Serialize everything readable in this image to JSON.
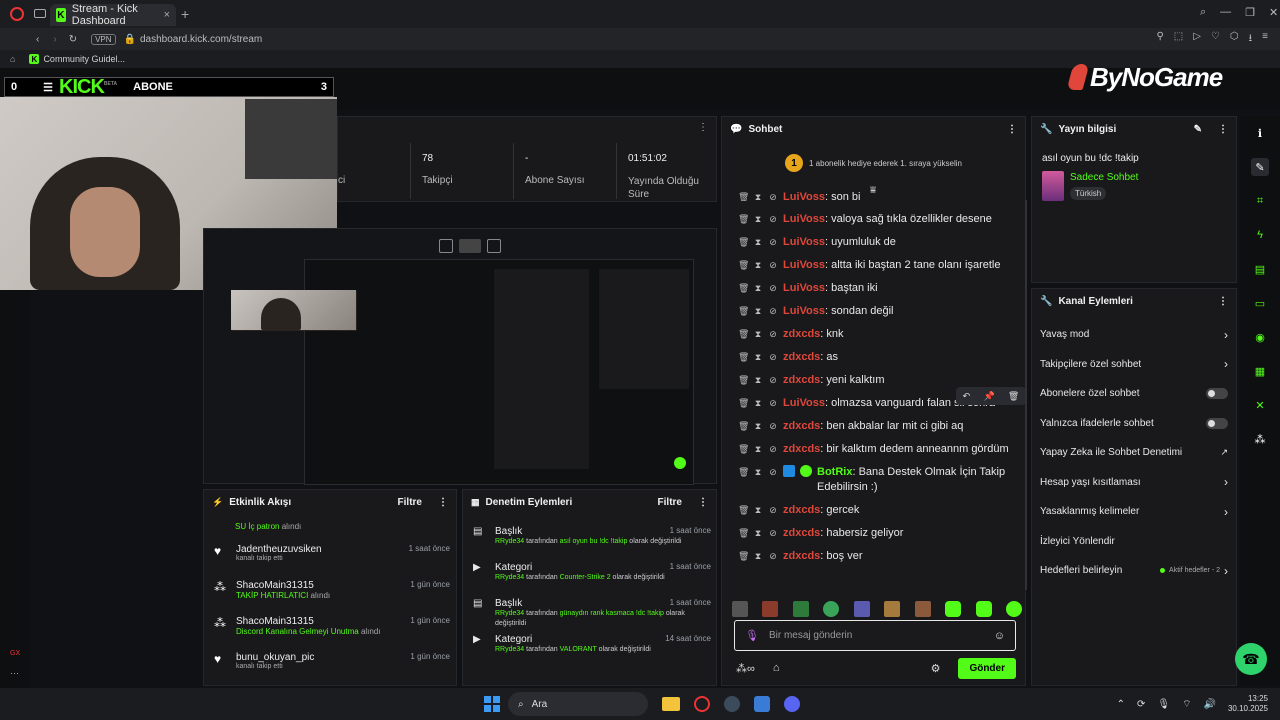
{
  "browser": {
    "tab_title": "Stream - Kick Dashboard",
    "url": "dashboard.kick.com/stream",
    "vpn": "VPN",
    "bookmark": "Community Guidel..."
  },
  "overlay": {
    "brand": "ByNoGame",
    "kick_logo": "KICK",
    "beta": "BETA",
    "abone": "ABONE",
    "abone_count": "3",
    "left_count": "0"
  },
  "stats": {
    "partial_label": "ci",
    "takipci_value": "78",
    "takipci_label": "Takipçi",
    "abone_value": "-",
    "abone_label": "Abone Sayısı",
    "time_value": "01:51:02",
    "time_label": "Yayında Olduğu Süre"
  },
  "chat": {
    "title": "Sohbet",
    "pinned_badge": "1",
    "pinned_text": "1 abonelik hediye ederek 1. sıraya yükselin",
    "cut_user": "LuiVoss",
    "cut_msg": ": son bi",
    "lines": [
      {
        "user": "LuiVoss",
        "color": "red",
        "msg": ": valoya sağ tıkla özellikler desene"
      },
      {
        "user": "LuiVoss",
        "color": "red",
        "msg": ": uyumluluk de"
      },
      {
        "user": "LuiVoss",
        "color": "red",
        "msg": ": altta iki baştan 2 tane olanı işaretle"
      },
      {
        "user": "LuiVoss",
        "color": "red",
        "msg": ": baştan iki"
      },
      {
        "user": "LuiVoss",
        "color": "red",
        "msg": ": sondan değil"
      },
      {
        "user": "zdxcds",
        "color": "red",
        "msg": ": knk"
      },
      {
        "user": "zdxcds",
        "color": "red",
        "msg": ": as"
      },
      {
        "user": "zdxcds",
        "color": "red",
        "msg": ": yeni kalktım"
      },
      {
        "user": "LuiVoss",
        "color": "red",
        "msg": ": olmazsa vanguardı falan sil sonra"
      },
      {
        "user": "zdxcds",
        "color": "red",
        "msg": ": ben akbalar lar mit ci gibi aq"
      },
      {
        "user": "zdxcds",
        "color": "red",
        "msg": ": bir kalktım dedem anneannm gördüm"
      },
      {
        "user": "BotRix",
        "color": "green",
        "msg": ": Bana Destek Olmak İçin Takip Edebilirsin :)"
      },
      {
        "user": "zdxcds",
        "color": "red",
        "msg": ": gercek"
      },
      {
        "user": "zdxcds",
        "color": "red",
        "msg": ": habersiz geliyor"
      },
      {
        "user": "zdxcds",
        "color": "red",
        "msg": ": boş ver"
      }
    ],
    "input_placeholder": "Bir mesaj gönderin",
    "send_label": "Gönder"
  },
  "info": {
    "title": "Yayın bilgisi",
    "stream_title": "asıl oyun bu !dc !takip",
    "category": "Sadece Sohbet",
    "language": "Türkish"
  },
  "kanal": {
    "title": "Kanal Eylemleri",
    "rows": [
      {
        "label": "Yavaş mod",
        "control": "arrow"
      },
      {
        "label": "Takipçilere özel sohbet",
        "control": "arrow"
      },
      {
        "label": "Abonelere özel sohbet",
        "control": "toggle"
      },
      {
        "label": "Yalnızca ifadelerle sohbet",
        "control": "toggle"
      },
      {
        "label": "Yapay Zeka ile Sohbet Denetimi",
        "control": "ext"
      },
      {
        "label": "Hesap yaşı kısıtlaması",
        "control": "arrow"
      },
      {
        "label": "Yasaklanmış kelimeler",
        "control": "arrow"
      },
      {
        "label": "İzleyici Yönlendir",
        "control": "none"
      },
      {
        "label": "Hedefleri belirleyin",
        "control": "goals"
      }
    ],
    "goals_status": "Aktif hedefler - 2"
  },
  "feed": {
    "title": "Etkinlik Akışı",
    "filter": "Filtre",
    "top_partial": "SU İç patron",
    "top_partial_suffix": "alındı",
    "items": [
      {
        "icon": "heart",
        "name": "Jadentheuzuvsiken",
        "sub": "kanalı takip etti",
        "time": "1 saat önce"
      },
      {
        "icon": "gift",
        "name": "ShacoMain31315",
        "sub": "TAKİP HATIRLATICI",
        "suffix": "alındı",
        "time": "1 gün önce"
      },
      {
        "icon": "gift",
        "name": "ShacoMain31315",
        "sub": "Discord Kanalına Gelmeyi Unutma",
        "suffix": "alındı",
        "time": "1 gün önce"
      },
      {
        "icon": "heart",
        "name": "bunu_okuyan_pic",
        "sub": "kanalı takip etti",
        "time": "1 gün önce"
      }
    ]
  },
  "moderation": {
    "title": "Denetim Eylemleri",
    "filter": "Filtre",
    "items": [
      {
        "type": "Başlık",
        "time": "1 saat önce",
        "user": "RRyde34",
        "pre": "tarafından",
        "val": "asıl oyun bu !dc !takip",
        "post": "olarak değiştirildi"
      },
      {
        "type": "Kategori",
        "time": "1 saat önce",
        "user": "RRyde34",
        "pre": "tarafından",
        "val": "Counter-Strike 2",
        "post": "olarak değiştirildi"
      },
      {
        "type": "Başlık",
        "time": "1 saat önce",
        "user": "RRyde34",
        "pre": "tarafından",
        "val": "günaydın rank kasmaca !dc !takip",
        "post": "olarak değiştirildi"
      },
      {
        "type": "Kategori",
        "time": "14 saat önce",
        "user": "RRyde34",
        "pre": "tarafından",
        "val": "VALORANT",
        "post": "olarak değiştirildi"
      }
    ]
  },
  "taskbar": {
    "search": "Ara",
    "time": "13:25",
    "date": "30.10.2025"
  },
  "colors": {
    "accent": "#53fc18",
    "user_red": "#e0473a",
    "panel": "#19191c"
  }
}
